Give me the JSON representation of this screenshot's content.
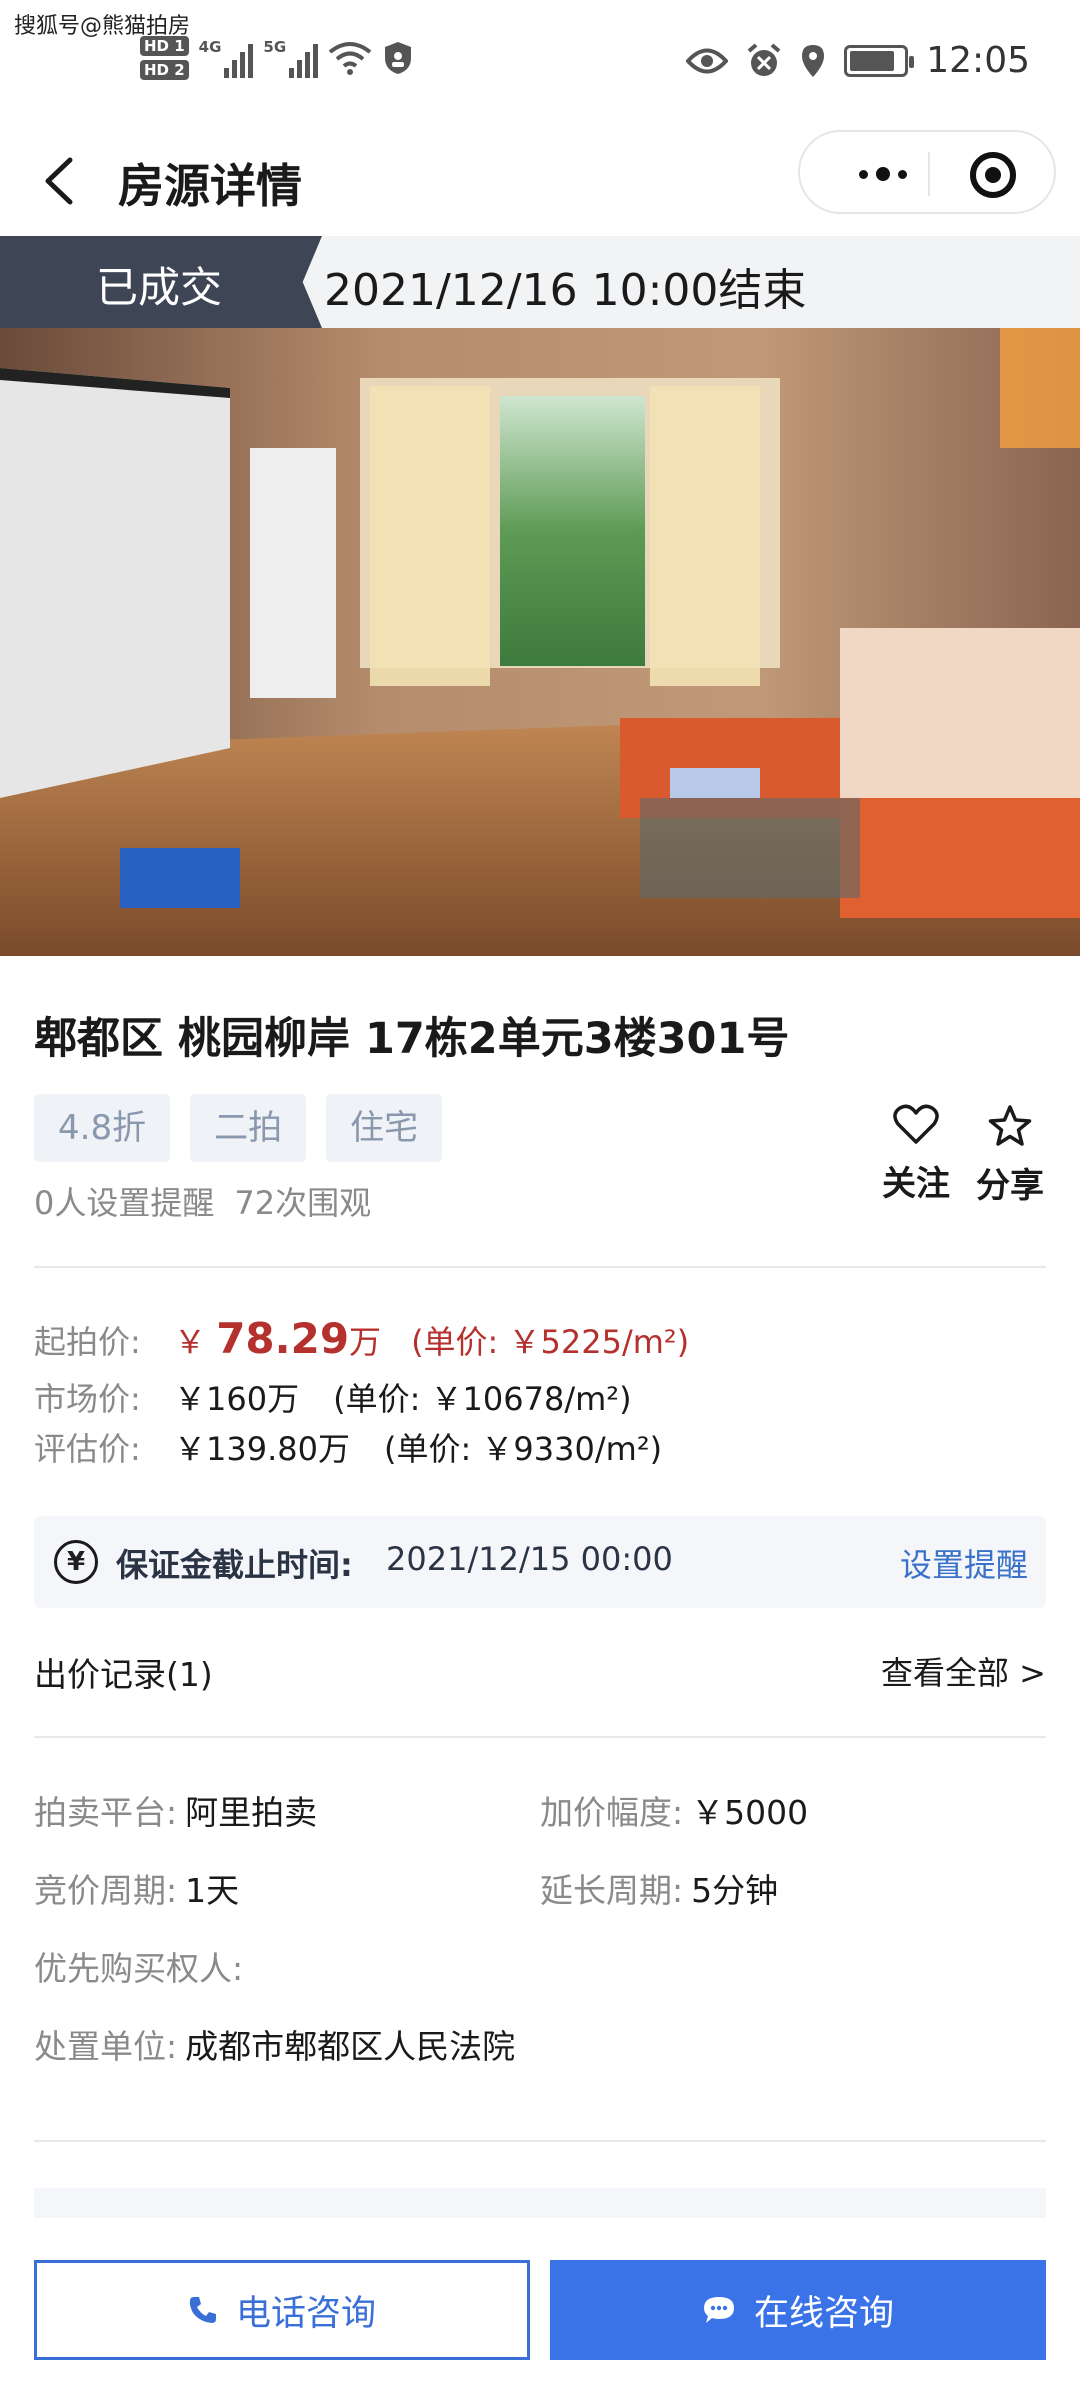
{
  "status_bar": {
    "watermark": "搜狐号@熊猫拍房",
    "sim1": "HD 1",
    "sim2": "HD 2",
    "net1": "4G",
    "net2": "5G",
    "time": "12:05",
    "battery_level": 0.85
  },
  "nav": {
    "title": "房源详情"
  },
  "auction": {
    "status": "已成交",
    "end_time": "2021/12/16 10:00结束"
  },
  "listing": {
    "title": "郫都区 桃园柳岸 17栋2单元3楼301号",
    "tags": [
      "4.8折",
      "二拍",
      "住宅"
    ],
    "reminders": "0人设置提醒",
    "views": "72次围观",
    "follow_label": "关注",
    "share_label": "分享"
  },
  "prices": {
    "start_label": "起拍价:",
    "start_currency": "￥",
    "start_value": "78.29",
    "start_unit": "万",
    "start_unit_price": "(单价: ￥5225/m²)",
    "market_label": "市场价:",
    "market_value": "￥160万",
    "market_unit_price": "(单价: ￥10678/m²)",
    "eval_label": "评估价:",
    "eval_value": "￥139.80万",
    "eval_unit_price": "(单价: ￥9330/m²)"
  },
  "deposit": {
    "icon": "yen-circle-icon",
    "label": "保证金截止时间:",
    "time": "2021/12/15 00:00",
    "action": "设置提醒"
  },
  "bids": {
    "title": "出价记录(1)",
    "view_all": "查看全部 >"
  },
  "info": {
    "platform_label": "拍卖平台:",
    "platform": "阿里拍卖",
    "increment_label": "加价幅度:",
    "increment": "￥5000",
    "cycle_label": "竞价周期:",
    "cycle": "1天",
    "extend_label": "延长周期:",
    "extend": "5分钟",
    "priority_label": "优先购买权人:",
    "court_label": "处置单位:",
    "court": "成都市郫都区人民法院"
  },
  "actions": {
    "phone": "电话咨询",
    "online": "在线咨询"
  },
  "colors": {
    "accent_blue": "#3a72e8",
    "price_red": "#b4312d",
    "tag_dark": "#3e4656"
  }
}
